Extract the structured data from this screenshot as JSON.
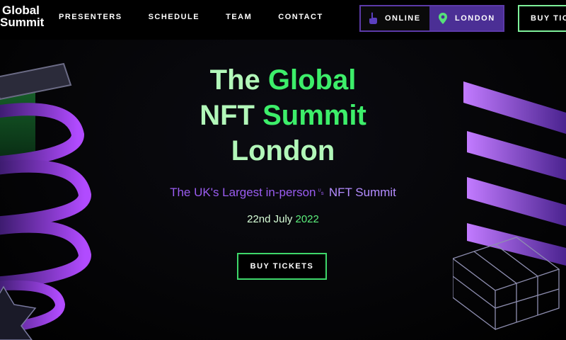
{
  "brand": {
    "line1": "Global",
    "line2": "Summit"
  },
  "nav": {
    "presenters": "PRESENTERS",
    "schedule": "SCHEDULE",
    "team": "TEAM",
    "contact": "CONTACT"
  },
  "location_toggle": {
    "online_label": "ONLINE",
    "online_icon": "pointer-hand-icon",
    "london_label": "LONDON",
    "london_icon": "map-pin-icon",
    "selected": "LONDON"
  },
  "header_cta": {
    "label": "BUY TIC"
  },
  "hero": {
    "title_the": "The",
    "title_global": "Global",
    "title_nft": "NFT",
    "title_summit": "Summit",
    "title_london": "London",
    "subtitle_main": "The UK's Largest in-person",
    "subtitle_glyph": "␟",
    "subtitle_end": " NFT Summit",
    "date_day": "22nd July",
    "date_year": " 2022",
    "cta_label": "BUY TICKETS"
  },
  "colors": {
    "accent_green": "#3dee6a",
    "accent_purple": "#5c3aa8",
    "bg": "#000000"
  }
}
